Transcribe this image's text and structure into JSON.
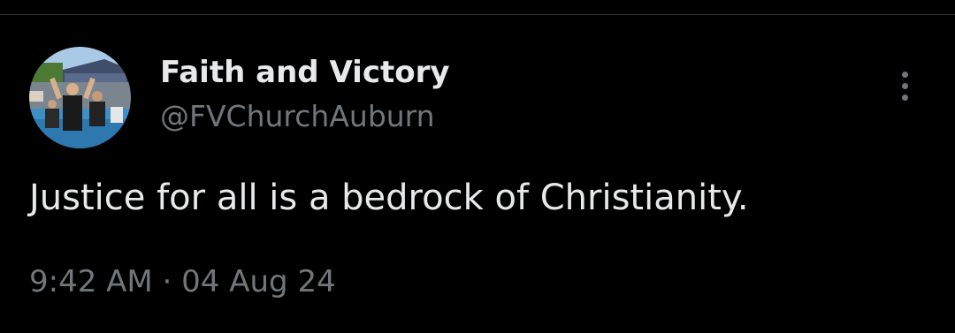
{
  "tweet": {
    "author": {
      "display_name": "Faith and Victory",
      "handle": "@FVChurchAuburn",
      "avatar_icon": "avatar-photo"
    },
    "more_icon": "more-options-icon",
    "text": "Justice for all is a bedrock of Christianity.",
    "timestamp": "9:42 AM · 04 Aug 24"
  },
  "colors": {
    "background": "#000000",
    "primary_text": "#e7e9ea",
    "secondary_text": "#71767b",
    "divider": "#2f3336"
  }
}
